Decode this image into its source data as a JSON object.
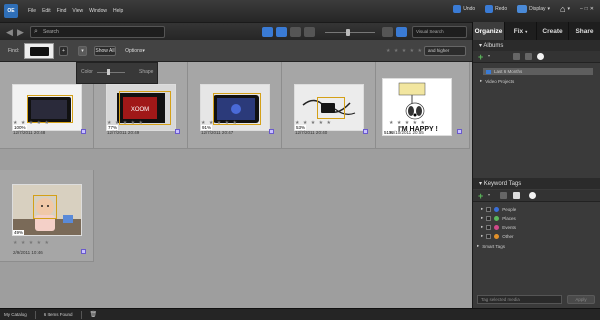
{
  "menubar": {
    "logo": "OE",
    "items": [
      "File",
      "Edit",
      "Find",
      "View",
      "Window",
      "Help"
    ],
    "undo": "Undo",
    "redo": "Redo",
    "display": "Display"
  },
  "toolbar": {
    "search_placeholder": "Search",
    "visual_search": "Visual Search"
  },
  "panel_tabs": [
    "Organize",
    "Fix",
    "Create",
    "Share"
  ],
  "filter_bar": {
    "find_label": "Find:",
    "show_all": "Show All",
    "options": "Options",
    "rating_filter": "★ ★ ★ ★ ★",
    "quality": "and higher"
  },
  "popup": {
    "left": "Color",
    "right": "Shape"
  },
  "media": [
    {
      "pct": "100%",
      "date": "12/7/2011 20:48",
      "stars": "★ ★ ★ ★ ★",
      "img": "tablet-white"
    },
    {
      "pct": "77%",
      "date": "12/7/2011 20:49",
      "stars": "★ ★ ★ ★ ★",
      "img": "xoom-box"
    },
    {
      "pct": "91%",
      "date": "12/7/2011 20:47",
      "stars": "★ ★ ★ ★ ★",
      "img": "tablet-dark"
    },
    {
      "pct": "53%",
      "date": "12/7/2011 20:40",
      "stars": "★ ★ ★ ★ ★",
      "img": "charger"
    },
    {
      "pct": "51%",
      "date": "20/10/2011 20:55",
      "stars": "★ ★ ★ ★ ★",
      "img": "happy-dog",
      "caption": "I'M HAPPY !"
    },
    {
      "pct": "49%",
      "date": "2/9/2011 10:46",
      "stars": "★ ★ ★ ★ ★",
      "img": "baby"
    }
  ],
  "albums": {
    "title": "Albums",
    "items": [
      {
        "label": "Last 6 Months",
        "selected": true
      },
      {
        "label": "Video Projects",
        "selected": false
      }
    ]
  },
  "keywords": {
    "title": "Keyword Tags",
    "items": [
      {
        "label": "People",
        "color": "#3a6fd8"
      },
      {
        "label": "Places",
        "color": "#5cb85c"
      },
      {
        "label": "Events",
        "color": "#d04a8a"
      },
      {
        "label": "Other",
        "color": "#e0902a"
      }
    ],
    "smart_tags": "Smart Tags",
    "tag_input_placeholder": "Tag selected media",
    "apply": "Apply"
  },
  "status": {
    "catalog": "My Catalog",
    "items_found": "6 Items Found"
  },
  "colors": {
    "accent": "#2f6fb8",
    "face_box": "#d4a017",
    "grid_bg": "#9e9e9e"
  }
}
